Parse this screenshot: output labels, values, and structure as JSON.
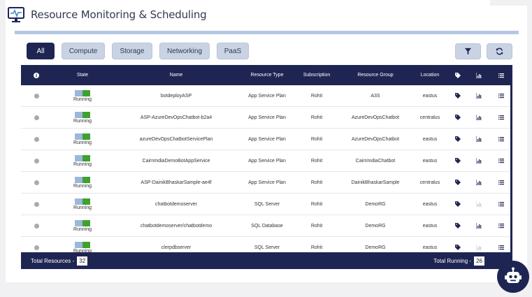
{
  "header": {
    "title": "Resource Monitoring & Scheduling"
  },
  "filters": [
    {
      "label": "All",
      "active": true
    },
    {
      "label": "Compute",
      "active": false
    },
    {
      "label": "Storage",
      "active": false
    },
    {
      "label": "Networking",
      "active": false
    },
    {
      "label": "PaaS",
      "active": false
    }
  ],
  "toolbar": {
    "filter_icon": "filter-icon",
    "refresh_icon": "refresh-icon"
  },
  "table": {
    "columns": {
      "info": "info-icon",
      "state": "State",
      "name": "Name",
      "type": "Resource Type",
      "subscription": "Subscription",
      "group": "Resource Group",
      "location": "Location",
      "tag": "tag-icon",
      "metrics": "chart-icon",
      "details": "list-icon"
    },
    "rows": [
      {
        "state": "Running",
        "name": "botdeployASP",
        "type": "App Service Plan",
        "subscription": "Rohit",
        "group": "A3S",
        "location": "eastus",
        "metrics_enabled": true
      },
      {
        "state": "Running",
        "name": "ASP-AzureDevOpsChatbot-b2a4",
        "type": "App Service Plan",
        "subscription": "Rohit",
        "group": "AzureDevOpsChatbot",
        "location": "centralus",
        "metrics_enabled": true
      },
      {
        "state": "Running",
        "name": "azureDevOpsChatbotServicePlan",
        "type": "App Service Plan",
        "subscription": "Rohit",
        "group": "AzureDevOpsChatbot",
        "location": "eastus",
        "metrics_enabled": true
      },
      {
        "state": "Running",
        "name": "CairnIndiaDemoBotAppService",
        "type": "App Service Plan",
        "subscription": "Rohit",
        "group": "CairnIndiaChatbot",
        "location": "eastus",
        "metrics_enabled": true
      },
      {
        "state": "Running",
        "name": "ASP-DainikBhaskarSample-ae4f",
        "type": "App Service Plan",
        "subscription": "Rohit",
        "group": "DainikBhaskarSample",
        "location": "centralus",
        "metrics_enabled": true
      },
      {
        "state": "Running",
        "name": "chatbotdemoserver",
        "type": "SQL Server",
        "subscription": "Rohit",
        "group": "DemoRG",
        "location": "eastus",
        "metrics_enabled": false
      },
      {
        "state": "Running",
        "name": "chatbotdemoserver/chatbotdemo",
        "type": "SQL Database",
        "subscription": "Rohit",
        "group": "DemoRG",
        "location": "eastus",
        "metrics_enabled": true
      },
      {
        "state": "Running",
        "name": "clerpdbserver",
        "type": "SQL Server",
        "subscription": "Rohit",
        "group": "DemoRG",
        "location": "eastus",
        "metrics_enabled": false
      }
    ]
  },
  "footer": {
    "total_label": "Total Resources -",
    "total_value": "32",
    "running_label": "Total Running -",
    "running_value": "26"
  },
  "colors": {
    "primary": "#1f2553",
    "accent": "#b4c6e4",
    "running_green": "#3fa12f",
    "toggle_blue": "#9bb7db"
  }
}
